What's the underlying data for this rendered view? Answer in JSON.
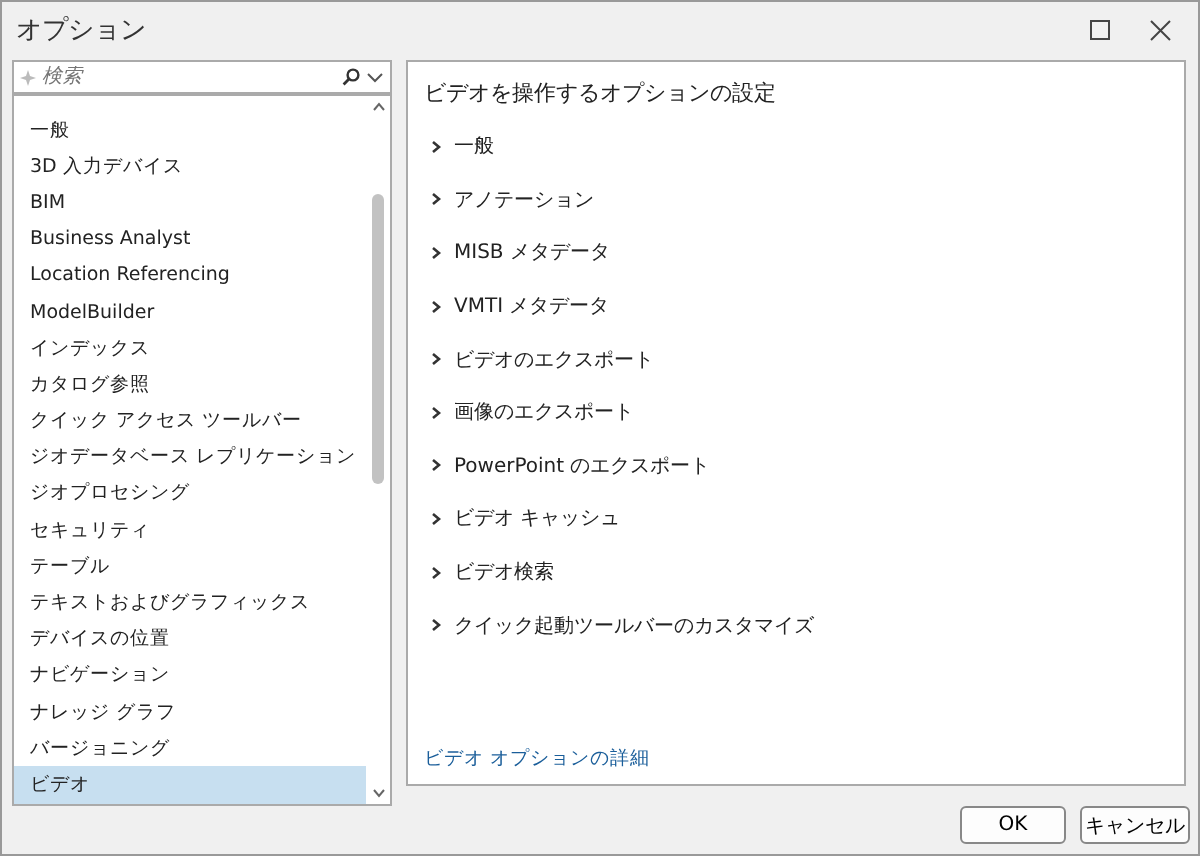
{
  "window": {
    "title": "オプション"
  },
  "search": {
    "placeholder": "検索"
  },
  "sidebar": {
    "items": [
      {
        "label": "一般",
        "selected": false
      },
      {
        "label": "3D 入力デバイス",
        "selected": false
      },
      {
        "label": "BIM",
        "selected": false
      },
      {
        "label": "Business Analyst",
        "selected": false
      },
      {
        "label": "Location Referencing",
        "selected": false
      },
      {
        "label": "ModelBuilder",
        "selected": false
      },
      {
        "label": "インデックス",
        "selected": false
      },
      {
        "label": "カタログ参照",
        "selected": false
      },
      {
        "label": "クイック アクセス ツールバー",
        "selected": false
      },
      {
        "label": "ジオデータベース レプリケーション",
        "selected": false
      },
      {
        "label": "ジオプロセシング",
        "selected": false
      },
      {
        "label": "セキュリティ",
        "selected": false
      },
      {
        "label": "テーブル",
        "selected": false
      },
      {
        "label": "テキストおよびグラフィックス",
        "selected": false
      },
      {
        "label": "デバイスの位置",
        "selected": false
      },
      {
        "label": "ナビゲーション",
        "selected": false
      },
      {
        "label": "ナレッジ グラフ",
        "selected": false
      },
      {
        "label": "バージョニング",
        "selected": false
      },
      {
        "label": "ビデオ",
        "selected": true
      }
    ]
  },
  "content": {
    "heading": "ビデオを操作するオプションの設定",
    "sections": [
      {
        "label": "一般",
        "expanded": false
      },
      {
        "label": "アノテーション",
        "expanded": false
      },
      {
        "label": "MISB メタデータ",
        "expanded": false
      },
      {
        "label": "VMTI メタデータ",
        "expanded": false
      },
      {
        "label": "ビデオのエクスポート",
        "expanded": false
      },
      {
        "label": "画像のエクスポート",
        "expanded": false
      },
      {
        "label": "PowerPoint のエクスポート",
        "expanded": false
      },
      {
        "label": "ビデオ キャッシュ",
        "expanded": false
      },
      {
        "label": "ビデオ検索",
        "expanded": false
      },
      {
        "label": "クイック起動ツールバーのカスタマイズ",
        "expanded": false
      }
    ],
    "link": "ビデオ オプションの詳細"
  },
  "buttons": [
    {
      "label": "OK"
    },
    {
      "label": "キャンセル"
    }
  ]
}
